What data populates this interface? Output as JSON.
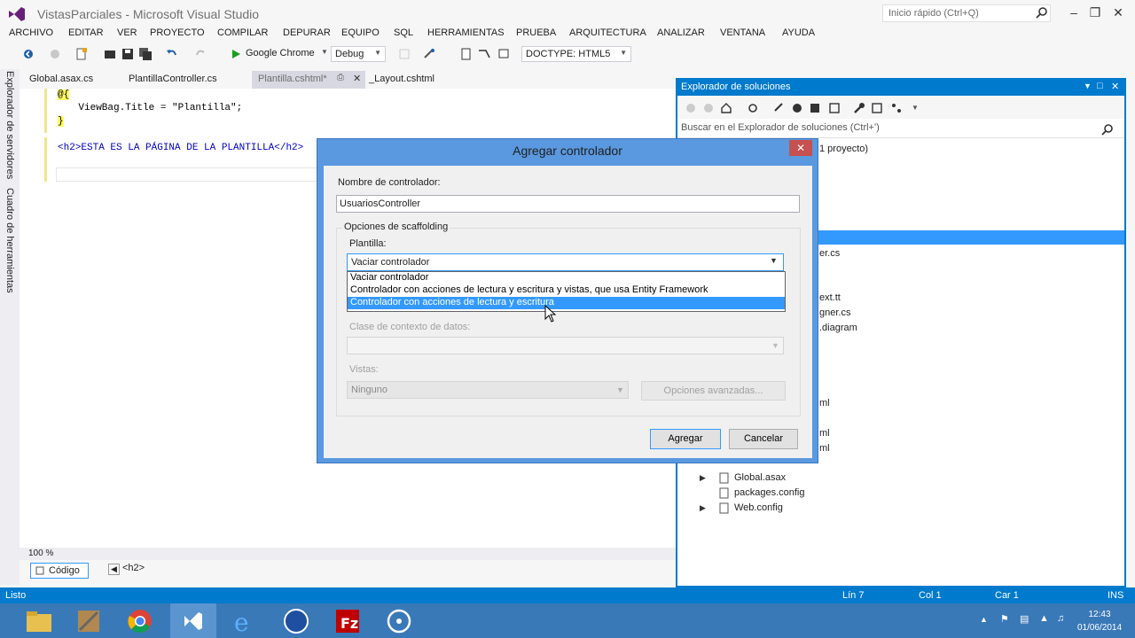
{
  "window": {
    "title": "VistasParciales - Microsoft Visual Studio",
    "quick_launch_placeholder": "Inicio rápido (Ctrl+Q)"
  },
  "menu": [
    "ARCHIVO",
    "EDITAR",
    "VER",
    "PROYECTO",
    "COMPILAR",
    "DEPURAR",
    "EQUIPO",
    "SQL",
    "HERRAMIENTAS",
    "PRUEBA",
    "ARQUITECTURA",
    "ANALIZAR",
    "VENTANA",
    "AYUDA"
  ],
  "toolbar": {
    "run_target": "Google Chrome",
    "configuration": "Debug",
    "doctype": "DOCTYPE: HTML5"
  },
  "side_tabs": [
    "Explorador de servidores",
    "Cuadro de herramientas"
  ],
  "doc_tabs": {
    "global": "Global.asax.cs",
    "plantilla_controller": "PlantillaController.cs",
    "plantilla": "Plantilla.cshtml*",
    "layout": "_Layout.cshtml"
  },
  "editor": {
    "lines": [
      "@{",
      "    ViewBag.Title = \"Plantilla\";",
      "}",
      "<h2>ESTA ES LA PÁGINA DE LA PLANTILLA</h2>"
    ],
    "zoom": "100 %",
    "view_button": "Código",
    "breadcrumb": "<h2>"
  },
  "solution_explorer": {
    "title": "Explorador de soluciones",
    "search_placeholder": "Buscar en el Explorador de soluciones (Ctrl+')",
    "partial_items": [
      "1 proyecto)",
      "er.cs",
      "ext.tt",
      "gner.cs",
      ".diagram",
      "ml",
      "ml",
      "ml"
    ],
    "items": [
      "Global.asax",
      "packages.config",
      "Web.config"
    ]
  },
  "dialog": {
    "title": "Agregar controlador",
    "close": "✕",
    "name_label": "Nombre de controlador:",
    "name_value": "UsuariosController",
    "scaffolding_label": "Opciones de scaffolding",
    "template_label": "Plantilla:",
    "template_selected": "Vaciar controlador",
    "template_options": [
      "Vaciar controlador",
      "Controlador con acciones de lectura y escritura y vistas, que usa Entity Framework",
      "Controlador con acciones de lectura y escritura"
    ],
    "context_label": "Clase de contexto de datos:",
    "views_label": "Vistas:",
    "views_value": "Ninguno",
    "advanced_button": "Opciones avanzadas...",
    "add_button": "Agregar",
    "cancel_button": "Cancelar"
  },
  "status": {
    "state": "Listo",
    "line": "Lín 7",
    "col": "Col 1",
    "car": "Car 1",
    "mode": "INS"
  },
  "taskbar": {
    "time": "12:43",
    "date": "01/06/2014"
  },
  "colors": {
    "accent": "#007acc",
    "dialog_frame": "#5a98df",
    "selection": "#3399ff",
    "taskbar": "#3a79b8"
  }
}
